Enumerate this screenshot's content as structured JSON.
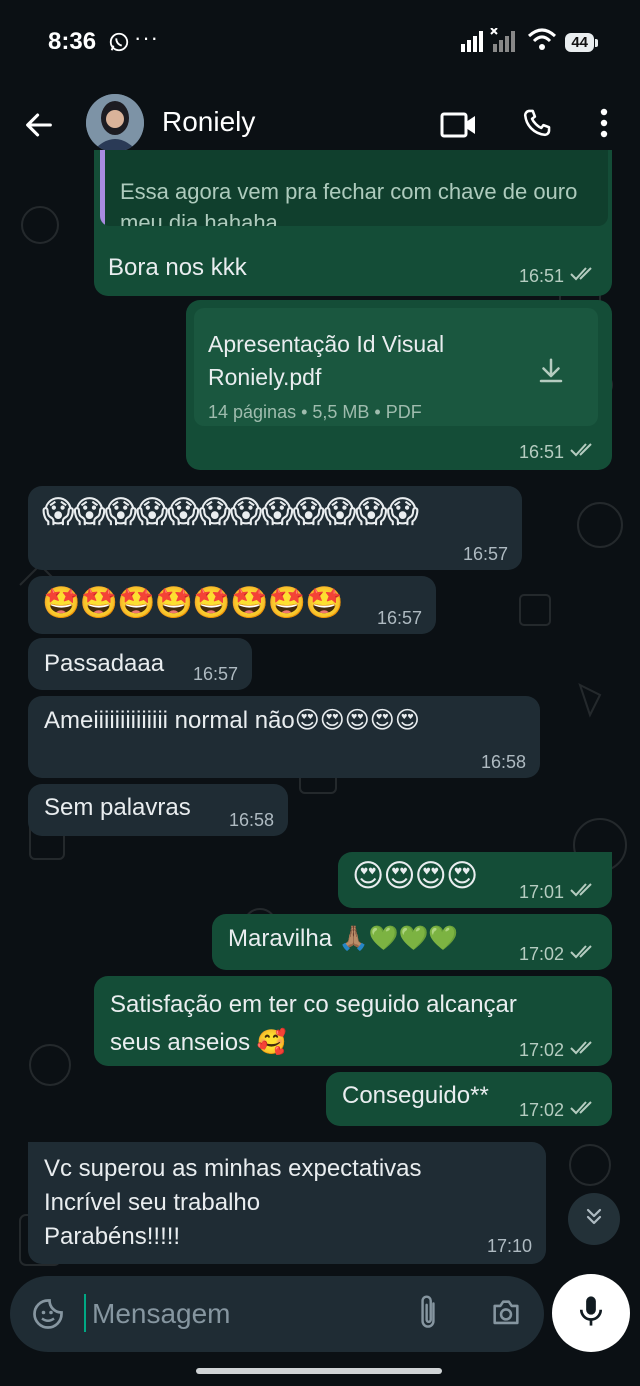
{
  "status_bar": {
    "time": "8:36",
    "dots": "···",
    "battery": "44"
  },
  "header": {
    "contact_name": "Roniely"
  },
  "messages": [
    {
      "quote_text": "Essa agora vem pra fechar com chave de ouro meu dia hahaha",
      "text": "Bora nos kkk",
      "time": "16:51"
    },
    {
      "doc_name_line1": "Apresentação Id Visual",
      "doc_name_line2": "Roniely.pdf",
      "doc_info": "14 páginas  •  5,5 MB  •  PDF",
      "time": "16:51"
    },
    {
      "text": "😱😱😱😱😱😱😱😱😱😱😱😱",
      "time": "16:57"
    },
    {
      "text": "🤩🤩🤩🤩🤩🤩🤩🤩",
      "time": "16:57"
    },
    {
      "text": "Passadaaa",
      "time": "16:57"
    },
    {
      "text": "Ameiiiiiiiiiiiiii normal não😍😍😍😍😍",
      "time": "16:58"
    },
    {
      "text": "Sem palavras",
      "time": "16:58"
    },
    {
      "text": "😍😍😍😍",
      "time": "17:01"
    },
    {
      "text": "Maravilha 🙏🏽💚💚💚",
      "time": "17:02"
    },
    {
      "text_line1": "Satisfação em ter co seguido alcançar",
      "text_line2": "seus anseios  🥰",
      "time": "17:02"
    },
    {
      "text": "Conseguido**",
      "time": "17:02"
    },
    {
      "text_line1": "Vc superou as minhas expectativas",
      "text_line2": "Incrível seu trabalho",
      "text_line3": "Parabéns!!!!!",
      "time": "17:10"
    }
  ],
  "input": {
    "placeholder": "Mensagem"
  },
  "colors": {
    "background": "#0b1014",
    "outgoing_bubble": "#144d37",
    "incoming_bubble": "#1f2c34",
    "accent": "#00a884",
    "quote_bar": "#a88be0"
  },
  "icons": [
    "back-arrow-icon",
    "video-call-icon",
    "phone-icon",
    "more-vert-icon",
    "download-icon",
    "double-check-icon",
    "chevron-double-down-icon",
    "sticker-icon",
    "attach-icon",
    "camera-icon",
    "mic-icon",
    "whatsapp-icon",
    "signal-icon",
    "wifi-icon"
  ]
}
